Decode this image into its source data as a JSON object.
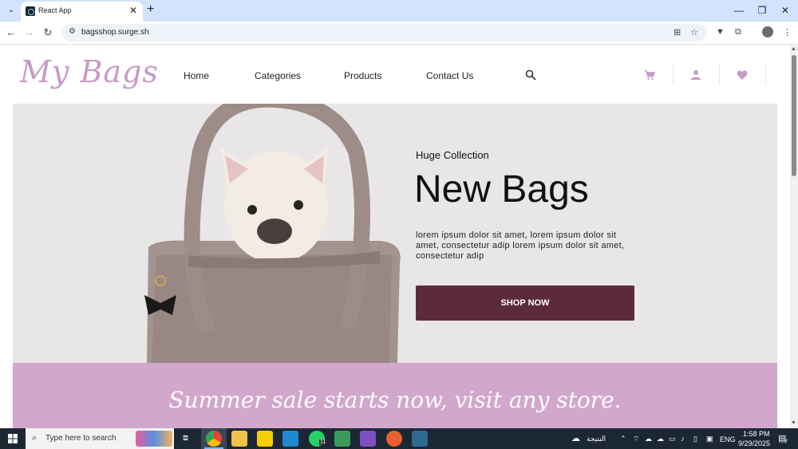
{
  "browser": {
    "tab_title": "React App",
    "url": "bagsshop.surge.sh"
  },
  "header": {
    "logo": "My Bags",
    "nav": [
      "Home",
      "Categories",
      "Products",
      "Contact Us"
    ]
  },
  "hero": {
    "subtitle": "Huge Collection",
    "title": "New Bags",
    "description": "lorem ipsum dolor sit amet, lorem ipsum dolor sit amet, consectetur adip lorem ipsum dolor sit amet, consectetur adip",
    "button": "SHOP NOW"
  },
  "sale_banner": {
    "text": "Summer sale starts now, visit any store."
  },
  "taskbar": {
    "search_placeholder": "Type here to search",
    "weather_label": "النتيجة",
    "language": "ENG",
    "time": "1:58 PM",
    "date": "9/29/2025",
    "whatsapp_badge": "11",
    "notification_count": "7"
  },
  "colors": {
    "accent": "#5b2b3d",
    "logo": "#c79ac6",
    "sale_bg": "#d1a7cb",
    "hero_bg": "#e8e6e7"
  }
}
